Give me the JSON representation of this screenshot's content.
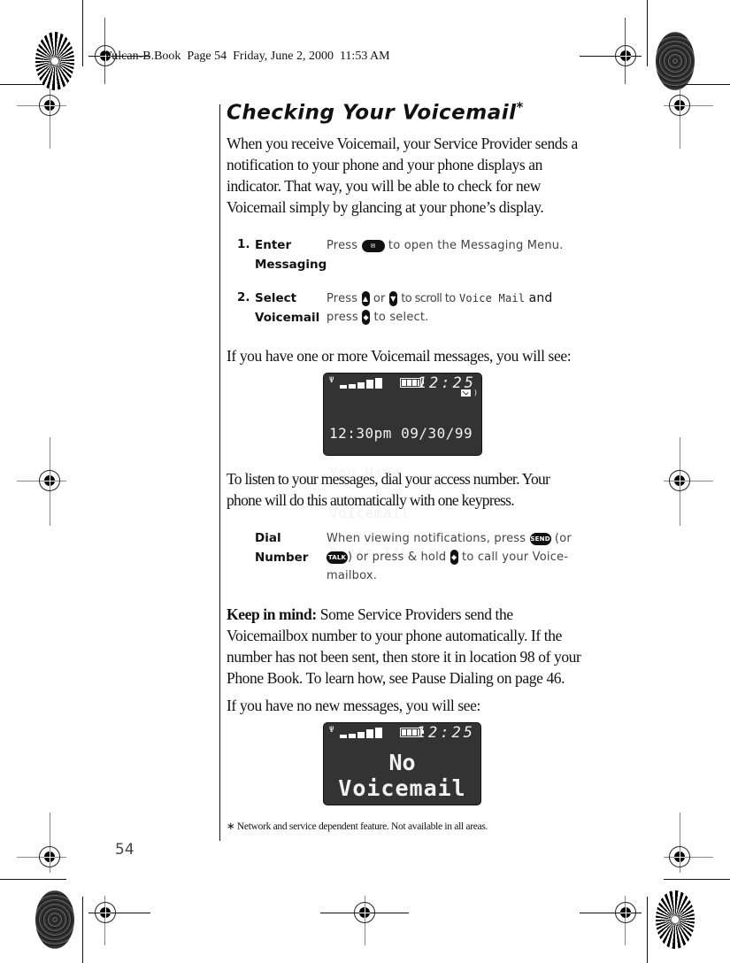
{
  "header": {
    "slug": "Vulcan-B.Book  Page 54  Friday, June 2, 2000  11:53 AM"
  },
  "title": {
    "text": "Checking Your Voicemail",
    "marker": "*"
  },
  "intro": "When you receive Voicemail, your Service Provider sends a notification to your phone and your phone displays an indicator. That way, you will be able to check for new Voicemail simply by glancing at your phone’s display.",
  "steps": [
    {
      "number": "1.",
      "label_line1": "Enter",
      "label_line2": "Messaging",
      "desc_before": "Press",
      "key_icon": "message-key",
      "desc_after": "to open the Messaging Menu."
    },
    {
      "number": "2.",
      "label_line1": "Select",
      "label_line2": "Voicemail",
      "desc_press": "Press",
      "desc_or": "or",
      "desc_scroll": "to scroll to",
      "lcd_item": "Voice Mail",
      "desc_and": "and",
      "desc_press2": "press",
      "desc_select": "to select."
    }
  ],
  "have_messages_text": "If you have one or more Voicemail messages, you will see:",
  "display1": {
    "clock": "12:25",
    "lines": [
      "12:30pm 09/30/99",
      "You Have",
      "Voicemail",
      "Press TALK to  ↓"
    ],
    "battery_level": "full",
    "signal_bars": 5
  },
  "listen_text": "To listen to your messages, dial your access number. Your phone will do this automatically with one keypress.",
  "dial": {
    "label_line1": "Dial",
    "label_line2": "Number",
    "desc_a": "When viewing notifications, press",
    "send_key": "SEND",
    "desc_b": "(or",
    "talk_key": "TALK",
    "desc_c": ") or press & hold",
    "desc_d": "to call your Voice-mailbox."
  },
  "keep_in_mind": {
    "label": "Keep in mind:",
    "text": " Some Service Providers send the Voicemailbox number to your phone automatically. If the number has not been sent, then store it in location 98 of your Phone Book. To learn how, see Pause Dialing on page 46."
  },
  "no_messages_text": "If you have no new messages, you will see:",
  "display2": {
    "clock": "12:25",
    "line1": "No",
    "line2": "Voicemail",
    "battery_level": "full",
    "signal_bars": 5
  },
  "footnote": "∗ Network and service dependent feature. Not available in all areas.",
  "page_number": "54"
}
